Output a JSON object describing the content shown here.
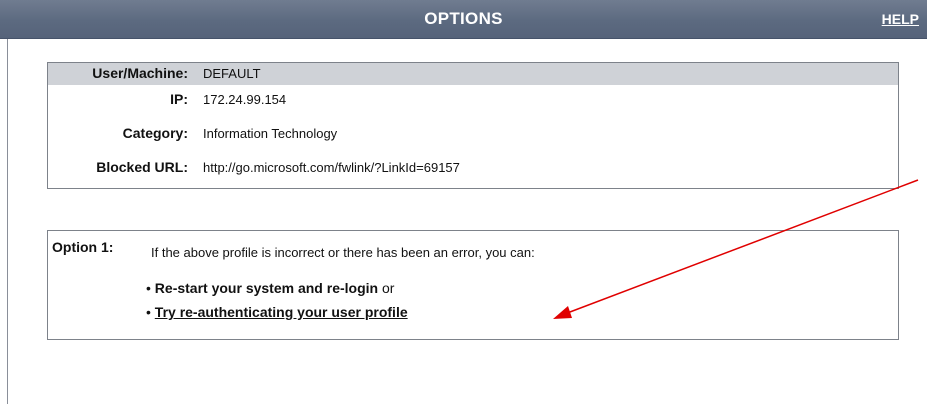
{
  "header": {
    "title": "OPTIONS",
    "help_label": "HELP"
  },
  "profile": {
    "rows": [
      {
        "label": "User/Machine:",
        "value": "DEFAULT"
      },
      {
        "label": "IP:",
        "value": "172.24.99.154"
      },
      {
        "label": "Category:",
        "value": "Information Technology"
      },
      {
        "label": "Blocked URL:",
        "value": "http://go.microsoft.com/fwlink/?LinkId=69157"
      }
    ]
  },
  "option1": {
    "label": "Option 1:",
    "description": "If the above profile is incorrect or there has been an error, you can:",
    "bullet_marker": "•",
    "restart_text": "Re-start your system and re-login",
    "restart_suffix": " or",
    "reauth_link": "Try re-authenticating your user profile"
  },
  "annotation": {
    "arrow_color": "#e00000"
  }
}
